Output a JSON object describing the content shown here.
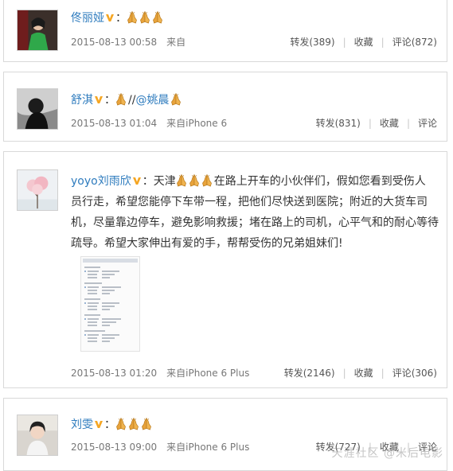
{
  "posts": [
    {
      "nickname": "佟丽娅",
      "colon": "：",
      "timestamp": "2015-08-13 00:58",
      "source": "来自",
      "repost": "转发(389)",
      "favorite": "收藏",
      "comment": "评论(872)"
    },
    {
      "nickname": "舒淇",
      "colon": "：",
      "mention_prefix": "//",
      "mention": "@姚晨",
      "timestamp": "2015-08-13 01:04",
      "source": "来自iPhone 6",
      "repost": "转发(831)",
      "favorite": "收藏",
      "comment": "评论"
    },
    {
      "nickname": "yoyo刘雨欣",
      "colon": "：",
      "text_lead": "天津",
      "text_line1_rest": "在路上开车的小伙伴们，假如您看到受伤人",
      "text_line2": "员行走，希望您能停下车带一程，把他们尽快送到医院；附近的大货车司",
      "text_line3": "机，尽量靠边停车，避免影响救援；堵在路上的司机，心平气和的耐心等待",
      "text_line4": "疏导。希望大家伸出有爱的手，帮帮受伤的兄弟姐妹们!",
      "timestamp": "2015-08-13 01:20",
      "source": "来自iPhone 6 Plus",
      "repost": "转发(2146)",
      "favorite": "收藏",
      "comment": "评论(306)"
    },
    {
      "nickname": "刘雯",
      "colon": "：",
      "timestamp": "2015-08-13 09:00",
      "source": "来自iPhone 6 Plus",
      "repost": "转发(727)",
      "favorite": "收藏",
      "comment": "评论"
    }
  ],
  "watermark": "天涯社区 @米后电影",
  "colors": {
    "link": "#2f7cbe",
    "badge": "#f5a623",
    "pray": "#e8a33c"
  },
  "icons": [
    "verified-v-icon",
    "praying-hands-emoji-icon"
  ]
}
